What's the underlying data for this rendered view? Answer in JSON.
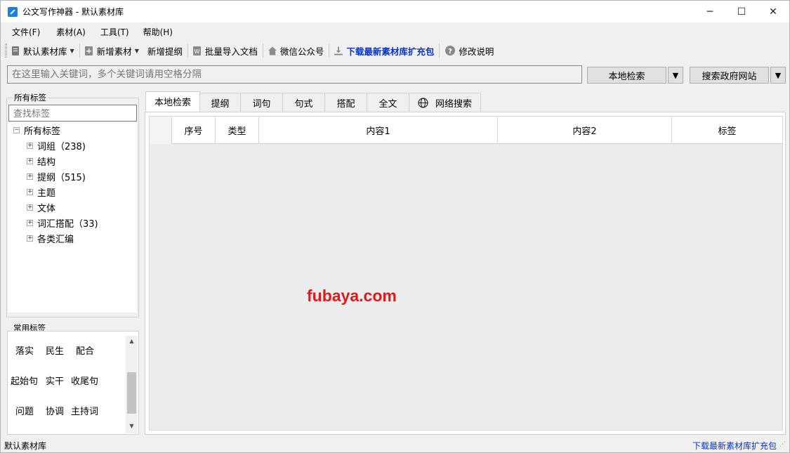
{
  "window": {
    "title": "公文写作神器 - 默认素材库",
    "minimize": "─",
    "maximize": "☐",
    "close": "✕"
  },
  "menu": [
    "文件(F)",
    "素材(A)",
    "工具(T)",
    "帮助(H)"
  ],
  "toolbar": {
    "library": "默认素材库",
    "add_material": "新增素材",
    "add_outline": "新增提纲",
    "batch_import": "批量导入文档",
    "wechat": "微信公众号",
    "download_pack": "下载最新素材库扩充包",
    "changelog": "修改说明"
  },
  "search": {
    "placeholder": "在这里输入关键词，多个关键词请用空格分隔",
    "local_button": "本地检索",
    "gov_button": "搜索政府网站"
  },
  "tags_panel": {
    "title": "所有标签",
    "search_placeholder": "查找标签",
    "root": "所有标签",
    "items": [
      "词组（238)",
      "结构",
      "提纲（515)",
      "主题",
      "文体",
      "词汇搭配（33)",
      "各类汇编"
    ]
  },
  "common_tags": {
    "title": "常用标签",
    "tags": [
      "落实",
      "民生",
      "配合",
      "起始句",
      "实干",
      "收尾句",
      "问题",
      "协调",
      "主持词"
    ]
  },
  "tabs": [
    "本地检索",
    "提纲",
    "词句",
    "句式",
    "搭配",
    "全文",
    "网络搜索"
  ],
  "grid": {
    "columns": [
      "",
      "序号",
      "类型",
      "内容1",
      "内容2",
      "标签"
    ]
  },
  "watermark": "fubaya.com",
  "status": {
    "left": "默认素材库",
    "right": "下载最新素材库扩充包"
  }
}
